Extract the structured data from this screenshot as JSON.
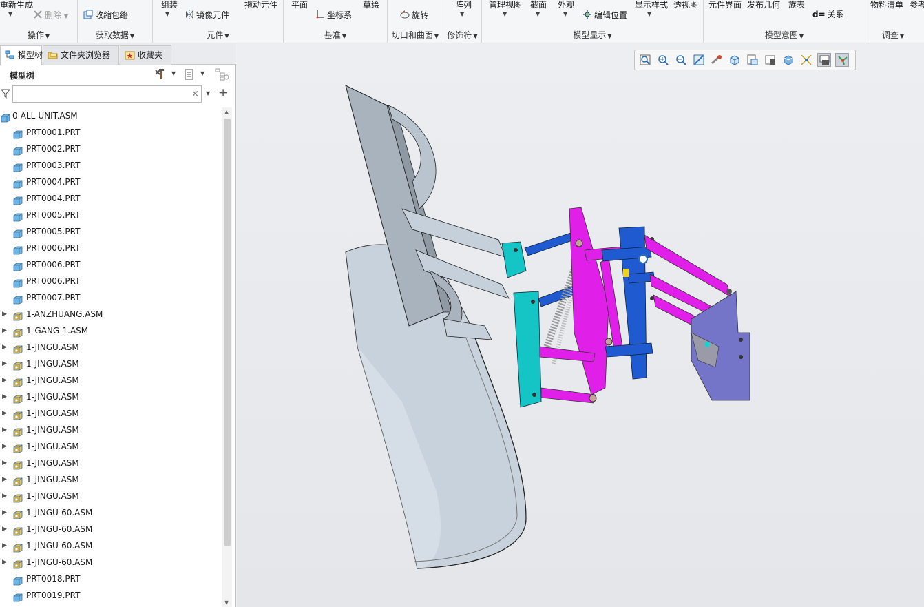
{
  "ribbon": {
    "groups": {
      "operations": {
        "label": "操作",
        "regen": "重新生成",
        "delete": "删除"
      },
      "get_data": {
        "label": "获取数据",
        "shrinkwrap": "收缩包络"
      },
      "component": {
        "label": "元件",
        "assemble": "组装",
        "mirror": "镜像元件",
        "drag": "拖动元件"
      },
      "datum": {
        "label": "基准",
        "plane": "平面",
        "csys": "坐标系",
        "sketch": "草绘"
      },
      "cut_surface": {
        "label": "切口和曲面",
        "revolve": "旋转"
      },
      "modifiers": {
        "label": "修饰符",
        "pattern": "阵列"
      },
      "model_display": {
        "label": "模型显示",
        "manage_views": "管理视图",
        "section": "截面",
        "appearance": "外观",
        "edit_position": "编辑位置",
        "display_style": "显示样式",
        "perspective": "透视图"
      },
      "model_intent": {
        "label": "模型意图",
        "component_interface": "元件界面",
        "publish_geom": "发布几何",
        "family_table": "族表",
        "relations": "关系"
      },
      "investigate": {
        "label": "调查",
        "bom": "物料清单",
        "reference": "参考"
      }
    }
  },
  "panel": {
    "tabs": [
      {
        "label": "模型树"
      },
      {
        "label": "文件夹浏览器"
      },
      {
        "label": "收藏夹"
      }
    ],
    "tree_title": "模型树",
    "filter": {
      "value": "",
      "placeholder": ""
    },
    "tree": [
      {
        "label": "0-ALL-UNIT.ASM",
        "kind": "asm-root",
        "expand": false
      },
      {
        "label": "PRT0001.PRT",
        "kind": "prt",
        "expand": false
      },
      {
        "label": "PRT0002.PRT",
        "kind": "prt",
        "expand": false
      },
      {
        "label": "PRT0003.PRT",
        "kind": "prt",
        "expand": false
      },
      {
        "label": "PRT0004.PRT",
        "kind": "prt",
        "expand": false
      },
      {
        "label": "PRT0004.PRT",
        "kind": "prt",
        "expand": false
      },
      {
        "label": "PRT0005.PRT",
        "kind": "prt",
        "expand": false
      },
      {
        "label": "PRT0005.PRT",
        "kind": "prt",
        "expand": false
      },
      {
        "label": "PRT0006.PRT",
        "kind": "prt",
        "expand": false
      },
      {
        "label": "PRT0006.PRT",
        "kind": "prt",
        "expand": false
      },
      {
        "label": "PRT0006.PRT",
        "kind": "prt",
        "expand": false
      },
      {
        "label": "PRT0007.PRT",
        "kind": "prt",
        "expand": false
      },
      {
        "label": "1-ANZHUANG.ASM",
        "kind": "asm",
        "expand": true
      },
      {
        "label": "1-GANG-1.ASM",
        "kind": "asm",
        "expand": true
      },
      {
        "label": "1-JINGU.ASM",
        "kind": "asm",
        "expand": true
      },
      {
        "label": "1-JINGU.ASM",
        "kind": "asm",
        "expand": true
      },
      {
        "label": "1-JINGU.ASM",
        "kind": "asm",
        "expand": true
      },
      {
        "label": "1-JINGU.ASM",
        "kind": "asm",
        "expand": true
      },
      {
        "label": "1-JINGU.ASM",
        "kind": "asm",
        "expand": true
      },
      {
        "label": "1-JINGU.ASM",
        "kind": "asm",
        "expand": true
      },
      {
        "label": "1-JINGU.ASM",
        "kind": "asm",
        "expand": true
      },
      {
        "label": "1-JINGU.ASM",
        "kind": "asm",
        "expand": true
      },
      {
        "label": "1-JINGU.ASM",
        "kind": "asm",
        "expand": true
      },
      {
        "label": "1-JINGU.ASM",
        "kind": "asm",
        "expand": true
      },
      {
        "label": "1-JINGU-60.ASM",
        "kind": "asm",
        "expand": true
      },
      {
        "label": "1-JINGU-60.ASM",
        "kind": "asm",
        "expand": true
      },
      {
        "label": "1-JINGU-60.ASM",
        "kind": "asm",
        "expand": true
      },
      {
        "label": "1-JINGU-60.ASM",
        "kind": "asm",
        "expand": true
      },
      {
        "label": "PRT0018.PRT",
        "kind": "prt",
        "expand": false
      },
      {
        "label": "PRT0019.PRT",
        "kind": "prt",
        "expand": false
      }
    ]
  },
  "colors": {
    "part_icon": "#6fb6e6",
    "asm_icon": "#e8c25a",
    "blade": "#c9d3dc",
    "cyan_plate": "#15c4c4",
    "magenta_link": "#e020e8",
    "blue_frame": "#1f5ad0",
    "violet_bracket": "#7474c8"
  }
}
